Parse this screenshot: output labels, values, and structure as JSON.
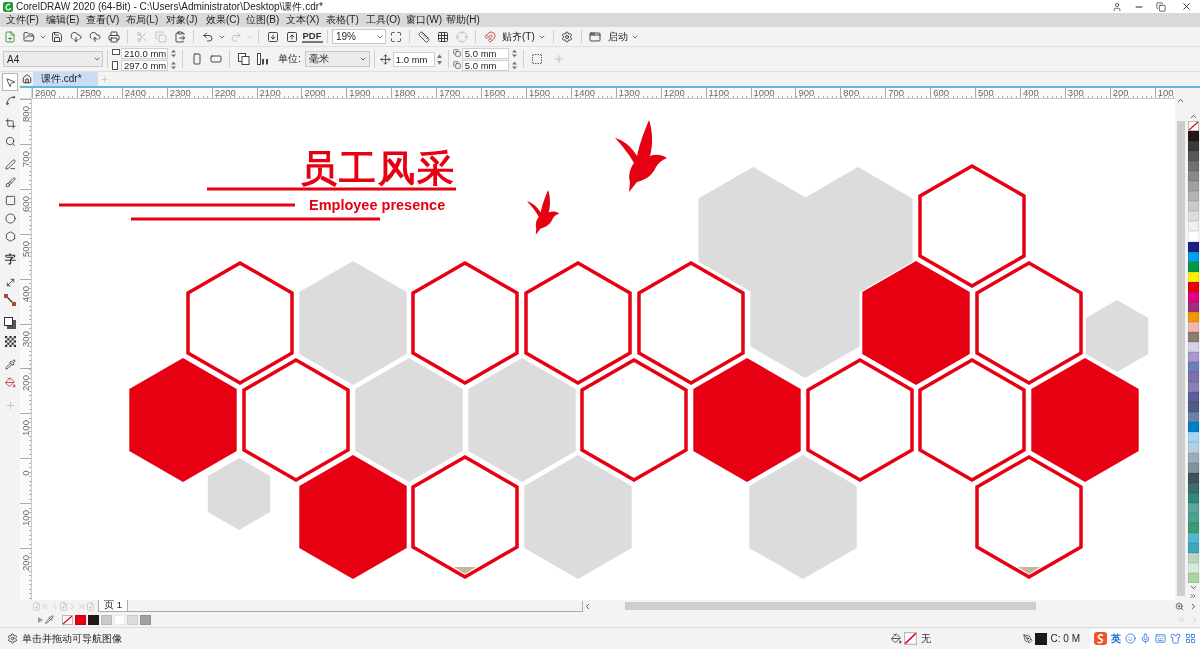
{
  "window": {
    "title": "CorelDRAW 2020 (64-Bit) - C:\\Users\\Administrator\\Desktop\\课件.cdr*"
  },
  "menu": [
    "文件(F)",
    "编辑(E)",
    "查看(V)",
    "布局(L)",
    "对象(J)",
    "效果(C)",
    "位图(B)",
    "文本(X)",
    "表格(T)",
    "工具(O)",
    "窗口(W)",
    "帮助(H)"
  ],
  "standard_toolbar": {
    "pdf_label": "PDF",
    "zoom_level": "19%",
    "snap": "贴齐(T)",
    "launch": "启动"
  },
  "property_bar": {
    "page_size": "A4",
    "page_width": "210.0 mm",
    "page_height": "297.0 mm",
    "units_label": "单位:",
    "units": "毫米",
    "nudge": "1.0 mm",
    "duplicate_x": "5.0 mm",
    "duplicate_y": "5.0 mm"
  },
  "document_tabs": [
    {
      "label": "课件.cdr*",
      "selected": true
    }
  ],
  "toolbox": [
    {
      "kind": "pick",
      "selected": true
    },
    {
      "kind": "shape",
      "selected": false
    },
    {
      "kind": "crop",
      "selected": false
    },
    {
      "kind": "zoom",
      "selected": false
    },
    {
      "kind": "freehand",
      "selected": false
    },
    {
      "kind": "artistic_media",
      "selected": false
    },
    {
      "kind": "rectangle",
      "selected": false
    },
    {
      "kind": "ellipse",
      "selected": false
    },
    {
      "kind": "polygon",
      "selected": false
    },
    {
      "kind": "text",
      "label": "字",
      "selected": false
    },
    {
      "kind": "dimension",
      "selected": false
    },
    {
      "kind": "connector",
      "selected": false
    },
    {
      "kind": "shadow",
      "selected": false
    },
    {
      "kind": "transparency",
      "selected": false
    },
    {
      "kind": "eyedropper",
      "selected": false
    },
    {
      "kind": "fill",
      "selected": false
    },
    {
      "kind": "add",
      "selected": false
    }
  ],
  "rulers": {
    "horizontal": [
      "2600",
      "2500",
      "2400",
      "2300",
      "2200",
      "2100",
      "2000",
      "1900",
      "1800",
      "1700",
      "1600",
      "1500",
      "1400",
      "1300",
      "1200",
      "1100",
      "1000",
      "900",
      "800",
      "700",
      "600",
      "500",
      "400",
      "300",
      "200",
      "100"
    ],
    "vertical": [
      "800",
      "700",
      "600",
      "500",
      "400",
      "300",
      "200",
      "100",
      "0",
      "100",
      "200"
    ]
  },
  "canvas": {
    "heading": "员工风采",
    "subheading": "Employee presence"
  },
  "color_palette": [
    {
      "kind": "none"
    },
    {
      "kind": "swatch",
      "color": "#231815"
    },
    {
      "kind": "swatch",
      "color": "#3e3a39"
    },
    {
      "kind": "swatch",
      "color": "#595757"
    },
    {
      "kind": "swatch",
      "color": "#727171"
    },
    {
      "kind": "swatch",
      "color": "#898989"
    },
    {
      "kind": "swatch",
      "color": "#9fa0a0"
    },
    {
      "kind": "swatch",
      "color": "#b5b5b6"
    },
    {
      "kind": "swatch",
      "color": "#c9caca"
    },
    {
      "kind": "swatch",
      "color": "#dcdddd"
    },
    {
      "kind": "swatch",
      "color": "#efefef"
    },
    {
      "kind": "swatch",
      "color": "#ffffff"
    },
    {
      "kind": "swatch",
      "color": "#1d2088"
    },
    {
      "kind": "swatch",
      "color": "#00a0e9"
    },
    {
      "kind": "swatch",
      "color": "#009944"
    },
    {
      "kind": "swatch",
      "color": "#fff100"
    },
    {
      "kind": "swatch",
      "color": "#e60012"
    },
    {
      "kind": "swatch",
      "color": "#e4007f"
    },
    {
      "kind": "swatch",
      "color": "#a0307f"
    },
    {
      "kind": "swatch",
      "color": "#f39800"
    },
    {
      "kind": "swatch",
      "color": "#f5b2b2"
    },
    {
      "kind": "swatch",
      "color": "#8c7b75"
    },
    {
      "kind": "swatch",
      "color": "#d6d0e8"
    },
    {
      "kind": "swatch",
      "color": "#a59aca"
    },
    {
      "kind": "swatch",
      "color": "#6c7fbf"
    },
    {
      "kind": "swatch",
      "color": "#7a73b0"
    },
    {
      "kind": "swatch",
      "color": "#8c7eb5"
    },
    {
      "kind": "swatch",
      "color": "#5a5e9c"
    },
    {
      "kind": "swatch",
      "color": "#515b85"
    },
    {
      "kind": "swatch",
      "color": "#6b82a8"
    },
    {
      "kind": "swatch",
      "color": "#0081cc"
    },
    {
      "kind": "swatch",
      "color": "#a3d6f5"
    },
    {
      "kind": "swatch",
      "color": "#b4cfe0"
    },
    {
      "kind": "swatch",
      "color": "#9aaeb9"
    },
    {
      "kind": "swatch",
      "color": "#7e939c"
    },
    {
      "kind": "swatch",
      "color": "#3f535a"
    },
    {
      "kind": "swatch",
      "color": "#3e6d6b"
    },
    {
      "kind": "swatch",
      "color": "#2e8a7c"
    },
    {
      "kind": "swatch",
      "color": "#60a39a"
    },
    {
      "kind": "swatch",
      "color": "#49a391"
    },
    {
      "kind": "swatch",
      "color": "#3b9c6f"
    },
    {
      "kind": "swatch",
      "color": "#52b8d1"
    },
    {
      "kind": "swatch",
      "color": "#3fa6bf"
    },
    {
      "kind": "swatch",
      "color": "#bcd5c0"
    },
    {
      "kind": "swatch",
      "color": "#d4ebd9"
    },
    {
      "kind": "swatch",
      "color": "#a8d5a3"
    }
  ],
  "page_navigator": {
    "tabs": [
      {
        "label": "页 1",
        "selected": true
      }
    ]
  },
  "document_palette": [
    {
      "kind": "none"
    },
    {
      "kind": "swatch",
      "color": "#e60012"
    },
    {
      "kind": "swatch",
      "color": "#231815"
    },
    {
      "kind": "swatch",
      "color": "#c9caca"
    },
    {
      "kind": "swatch",
      "color": "#ffffff"
    },
    {
      "kind": "swatch",
      "color": "#dcdddd"
    },
    {
      "kind": "swatch",
      "color": "#9fa0a0"
    }
  ],
  "status_bar": {
    "hint": "单击并拖动可导航图像",
    "fill": {
      "kind": "none",
      "label": "无"
    },
    "outline": {
      "color": "#231815",
      "readout": "C: 0 M"
    }
  },
  "input_method": {
    "mode": "英"
  }
}
